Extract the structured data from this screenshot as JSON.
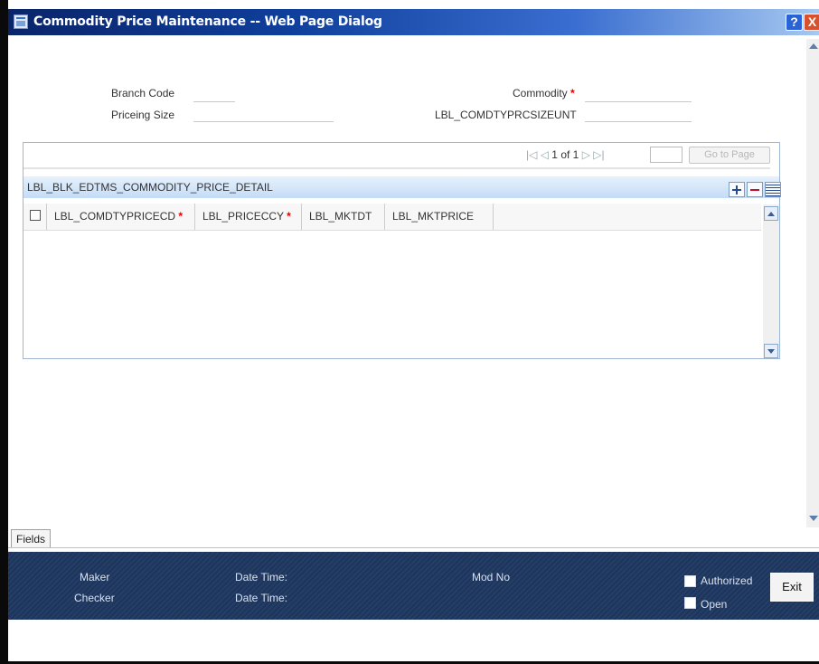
{
  "window": {
    "title": "Commodity Price Maintenance -- Web Page Dialog",
    "help_label": "?",
    "close_label": "X"
  },
  "form": {
    "branch_code_label": "Branch Code",
    "branch_code_value": "",
    "commodity_label": "Commodity",
    "commodity_value": "",
    "pricing_size_label": "Priceing Size",
    "pricing_size_value": "",
    "size_unit_label": "LBL_COMDTYPRCSIZEUNT",
    "size_unit_value": "",
    "required_mark": "*"
  },
  "pager": {
    "current": "1",
    "of_label": "of",
    "total": "1",
    "page_input_value": "",
    "go_to_page_label": "Go to Page"
  },
  "block": {
    "title": "LBL_BLK_EDTMS_COMMODITY_PRICE_DETAIL",
    "columns": [
      "LBL_COMDTYPRICECD",
      "LBL_PRICECCY",
      "LBL_MKTDT",
      "LBL_MKTPRICE"
    ],
    "required_columns": [
      true,
      true,
      false,
      false
    ],
    "rows": []
  },
  "tabs": {
    "fields_label": "Fields"
  },
  "footer": {
    "maker_label": "Maker",
    "checker_label": "Checker",
    "date_time_label": "Date Time:",
    "mod_no_label": "Mod No",
    "authorized_label": "Authorized",
    "open_label": "Open",
    "exit_label": "Exit"
  },
  "colors": {
    "titlebar_start": "#0a246a",
    "titlebar_end": "#a6c8f0",
    "footer_bg": "#243e68",
    "required": "#e00000",
    "block_header": "#c4dcf6"
  }
}
